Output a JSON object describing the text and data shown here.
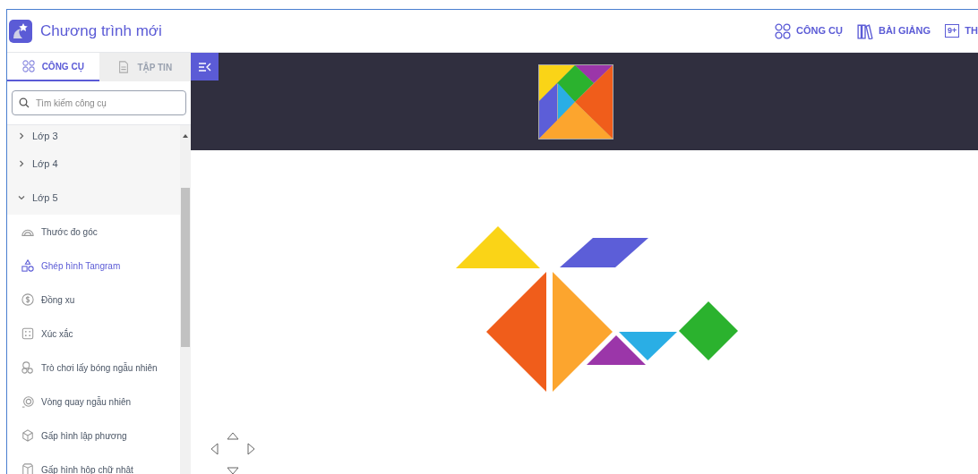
{
  "app": {
    "title": "Chương trình mới"
  },
  "top_nav": [
    {
      "label": "CÔNG CỤ",
      "kind": "circles"
    },
    {
      "label": "BÀI GIẢNG",
      "kind": "books"
    },
    {
      "label": "TH",
      "kind": "badge",
      "badge": "9+"
    }
  ],
  "tabs": [
    {
      "label": "CÔNG CỤ",
      "selected": true,
      "kind": "circles"
    },
    {
      "label": "TẬP TIN",
      "selected": false,
      "kind": "file"
    }
  ],
  "search": {
    "placeholder": "Tìm kiếm công cụ"
  },
  "tree": [
    {
      "label": "Lớp 3",
      "expanded": false
    },
    {
      "label": "Lớp 4",
      "expanded": false
    },
    {
      "label": "Lớp 5",
      "expanded": true,
      "children": [
        {
          "label": "Thước đo góc",
          "kind": "protractor",
          "selected": false
        },
        {
          "label": "Ghép hình Tangram",
          "kind": "shapes",
          "selected": true
        },
        {
          "label": "Đồng xu",
          "kind": "coin",
          "selected": false
        },
        {
          "label": "Xúc xắc",
          "kind": "dice",
          "selected": false
        },
        {
          "label": "Trò chơi lấy bóng ngẫu nhiên",
          "kind": "balls",
          "selected": false
        },
        {
          "label": "Vòng quay ngẫu nhiên",
          "kind": "spinner",
          "selected": false
        },
        {
          "label": "Gấp hình lập phương",
          "kind": "cube",
          "selected": false
        },
        {
          "label": "Gấp hình hộp chữ nhật",
          "kind": "box",
          "selected": false
        }
      ]
    }
  ]
}
